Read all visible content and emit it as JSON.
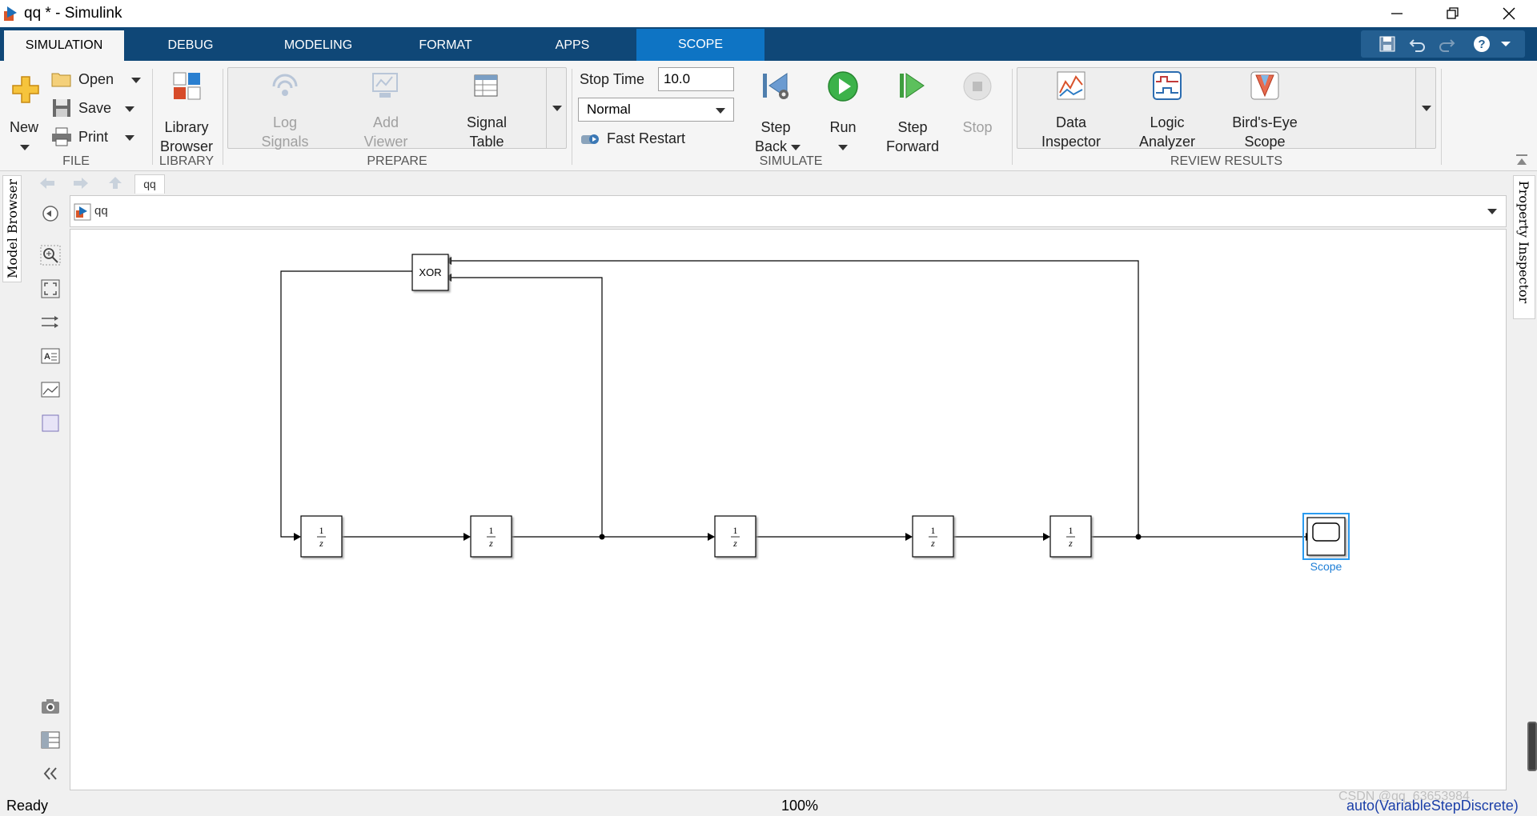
{
  "window": {
    "title": "qq * - Simulink"
  },
  "tabs": [
    {
      "label": "SIMULATION"
    },
    {
      "label": "DEBUG"
    },
    {
      "label": "MODELING"
    },
    {
      "label": "FORMAT"
    },
    {
      "label": "APPS"
    },
    {
      "label": "SCOPE"
    }
  ],
  "ribbon": {
    "file": {
      "new_label": "New",
      "open_label": "Open",
      "save_label": "Save",
      "print_label": "Print",
      "section_label": "FILE"
    },
    "library": {
      "line1": "Library",
      "line2": "Browser",
      "section_label": "LIBRARY"
    },
    "prepare": {
      "log_line1": "Log",
      "log_line2": "Signals",
      "add_line1": "Add",
      "add_line2": "Viewer",
      "table_line1": "Signal",
      "table_line2": "Table",
      "section_label": "PREPARE"
    },
    "simulate": {
      "stop_time_label": "Stop Time",
      "stop_time_value": "10.0",
      "mode_value": "Normal",
      "fast_restart_label": "Fast Restart",
      "step_back_line1": "Step",
      "step_back_line2": "Back",
      "run_label": "Run",
      "step_fwd_line1": "Step",
      "step_fwd_line2": "Forward",
      "stop_label": "Stop",
      "section_label": "SIMULATE"
    },
    "review": {
      "data_line1": "Data",
      "data_line2": "Inspector",
      "logic_line1": "Logic",
      "logic_line2": "Analyzer",
      "birds_line1": "Bird's-Eye",
      "birds_line2": "Scope",
      "section_label": "REVIEW RESULTS"
    }
  },
  "model_browser_label": "Model Browser",
  "property_inspector_label": "Property Inspector",
  "breadcrumb_tab": "qq",
  "address": "qq",
  "diagram": {
    "xor_label": "XOR",
    "delay_num": "1",
    "delay_den": "z",
    "scope_label": "Scope"
  },
  "status": {
    "left": "Ready",
    "zoom": "100%",
    "solver": "auto(VariableStepDiscrete)",
    "watermark": "CSDN @qq_63653984"
  },
  "colors": {
    "tab_bar": "#0f4777",
    "scope_tab": "#0e74c4",
    "selection": "#1e90ff"
  }
}
